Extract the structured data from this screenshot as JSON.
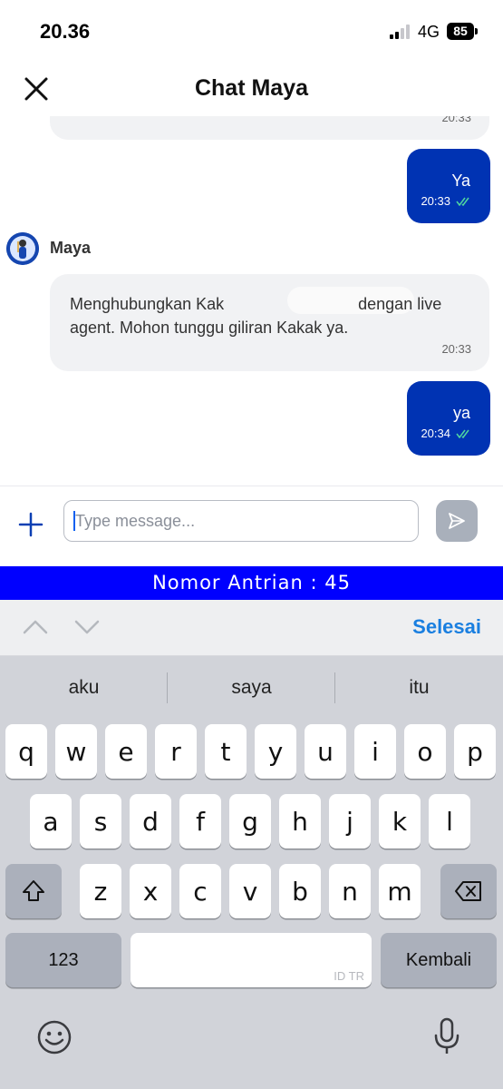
{
  "status_bar": {
    "time": "20.36",
    "network": "4G",
    "battery": "85"
  },
  "header": {
    "title": "Chat Maya"
  },
  "chat": {
    "messages": [
      {
        "from": "bot",
        "time": "20:33"
      },
      {
        "from": "user",
        "text": "Ya",
        "time": "20:33"
      },
      {
        "from": "bot",
        "sender": "Maya",
        "text_part1": "Menghubungkan Kak",
        "text_part2": "dengan live",
        "text_line2": "agent. Mohon tunggu giliran Kakak ya.",
        "time": "20:33"
      },
      {
        "from": "user",
        "text": "ya",
        "time": "20:34"
      }
    ]
  },
  "composer": {
    "placeholder": "Type message..."
  },
  "queue_banner": {
    "text": "Nomor Antrian : 45"
  },
  "keyboard": {
    "done_label": "Selesai",
    "suggestions": [
      "aku",
      "saya",
      "itu"
    ],
    "row1": [
      "q",
      "w",
      "e",
      "r",
      "t",
      "y",
      "u",
      "i",
      "o",
      "p"
    ],
    "row2": [
      "a",
      "s",
      "d",
      "f",
      "g",
      "h",
      "j",
      "k",
      "l"
    ],
    "row3": [
      "z",
      "x",
      "c",
      "v",
      "b",
      "n",
      "m"
    ],
    "numbers_label": "123",
    "space_tag": "ID TR",
    "return_label": "Kembali"
  },
  "colors": {
    "accent": "#0033b3",
    "banner": "#0000ff",
    "done": "#1a7fe0"
  }
}
